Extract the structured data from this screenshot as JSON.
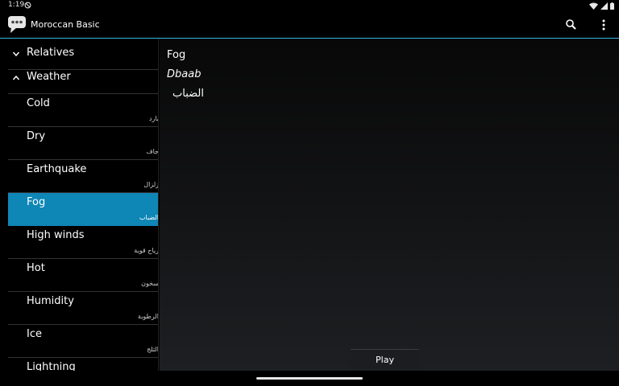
{
  "status_bar": {
    "time": "1:19"
  },
  "app": {
    "title": "Moroccan Basic"
  },
  "colors": {
    "accent": "#33b5e5",
    "selected_bg": "#0e86b6"
  },
  "icons": {
    "app": "speech-bubble-icon",
    "search": "search-icon",
    "overflow": "more-vert-icon",
    "chevron_down": "chevron-down-icon",
    "chevron_up": "chevron-up-icon"
  },
  "list": {
    "groups": [
      {
        "label": "Relatives",
        "expanded": false
      },
      {
        "label": "Weather",
        "expanded": true
      }
    ],
    "items": [
      {
        "english": "Cold",
        "arabic": "بارد"
      },
      {
        "english": "Dry",
        "arabic": "جاف"
      },
      {
        "english": "Earthquake",
        "arabic": "زلزال"
      },
      {
        "english": "Fog",
        "arabic": "الضباب",
        "selected": true
      },
      {
        "english": "High winds",
        "arabic": "رياح قوية"
      },
      {
        "english": "Hot",
        "arabic": "سخون"
      },
      {
        "english": "Humidity",
        "arabic": "الرطوبة"
      },
      {
        "english": "Ice",
        "arabic": "الثلج"
      },
      {
        "english": "Lightning",
        "arabic": ""
      }
    ]
  },
  "detail": {
    "english": "Fog",
    "transliteration": "Dbaab",
    "arabic": "الضباب",
    "play_label": "Play"
  }
}
